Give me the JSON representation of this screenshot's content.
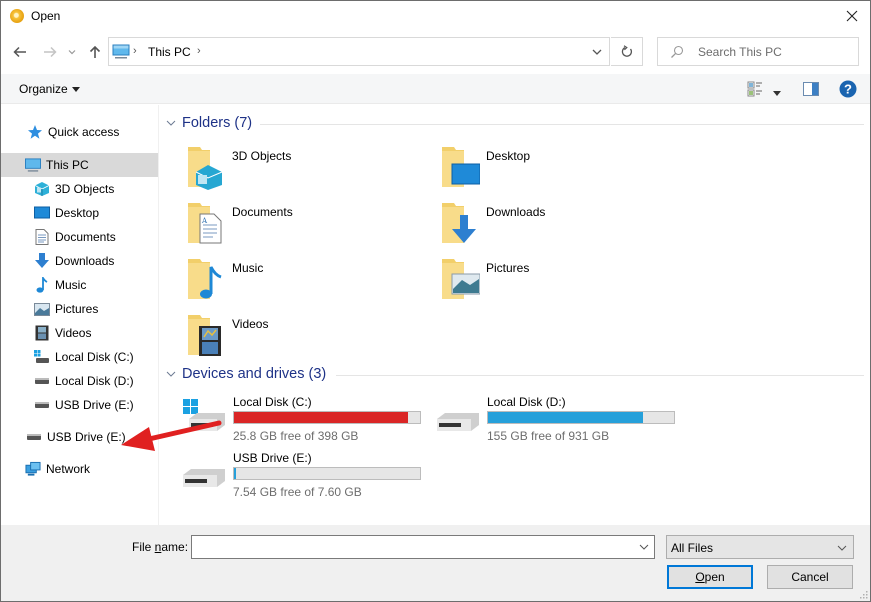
{
  "window": {
    "title": "Open",
    "app_icon": "chrome-canary-icon",
    "close_icon": "close-icon"
  },
  "nav": {
    "back_icon": "arrow-left-icon",
    "forward_icon": "arrow-right-icon",
    "recent_icon": "chevron-down-icon",
    "up_icon": "arrow-up-icon",
    "address": {
      "location_icon": "this-pc-icon",
      "path": [
        "This PC"
      ],
      "dropdown_icon": "chevron-down-icon"
    },
    "refresh_icon": "refresh-icon",
    "search": {
      "placeholder": "Search This PC",
      "value": "",
      "icon": "search-icon"
    }
  },
  "toolbar": {
    "organize_label": "Organize",
    "view_icon": "change-view-icon",
    "view_dropdown_icon": "caret-down-icon",
    "preview_pane_icon": "preview-pane-icon",
    "help_icon": "help-icon"
  },
  "sidebar": {
    "items": [
      {
        "label": "Quick access",
        "icon": "star-icon",
        "level": 0,
        "selected": false
      },
      {
        "label": "This PC",
        "icon": "this-pc-icon",
        "level": 0,
        "selected": true
      },
      {
        "label": "3D Objects",
        "icon": "cube-icon",
        "level": 1,
        "selected": false
      },
      {
        "label": "Desktop",
        "icon": "desktop-icon",
        "level": 1,
        "selected": false
      },
      {
        "label": "Documents",
        "icon": "document-icon",
        "level": 1,
        "selected": false
      },
      {
        "label": "Downloads",
        "icon": "download-icon",
        "level": 1,
        "selected": false
      },
      {
        "label": "Music",
        "icon": "music-note-icon",
        "level": 1,
        "selected": false
      },
      {
        "label": "Pictures",
        "icon": "picture-icon",
        "level": 1,
        "selected": false
      },
      {
        "label": "Videos",
        "icon": "film-icon",
        "level": 1,
        "selected": false
      },
      {
        "label": "Local Disk (C:)",
        "icon": "windows-drive-icon",
        "level": 1,
        "selected": false
      },
      {
        "label": "Local Disk (D:)",
        "icon": "drive-icon",
        "level": 1,
        "selected": false
      },
      {
        "label": "USB Drive (E:)",
        "icon": "drive-icon",
        "level": 1,
        "selected": false
      },
      {
        "label": "USB Drive (E:)",
        "icon": "drive-icon",
        "level": 0,
        "selected": false
      },
      {
        "label": "Network",
        "icon": "network-icon",
        "level": 0,
        "selected": false
      }
    ]
  },
  "content": {
    "folders_group": {
      "title": "Folders (7)",
      "items": [
        {
          "name": "3D Objects",
          "overlay": "cube-icon"
        },
        {
          "name": "Desktop",
          "overlay": "desktop-icon"
        },
        {
          "name": "Documents",
          "overlay": "document-icon"
        },
        {
          "name": "Downloads",
          "overlay": "download-icon"
        },
        {
          "name": "Music",
          "overlay": "music-note-icon"
        },
        {
          "name": "Pictures",
          "overlay": "picture-icon"
        },
        {
          "name": "Videos",
          "overlay": "film-icon"
        }
      ]
    },
    "drives_group": {
      "title": "Devices and drives (3)",
      "items": [
        {
          "name": "Local Disk (C:)",
          "free_text": "25.8 GB free of 398 GB",
          "used_fraction": 0.935,
          "bar_color": "#da2626",
          "icon": "windows-drive-icon"
        },
        {
          "name": "Local Disk (D:)",
          "free_text": "155 GB free of 931 GB",
          "used_fraction": 0.834,
          "bar_color": "#26a0da",
          "icon": "drive-icon"
        },
        {
          "name": "USB Drive (E:)",
          "free_text": "7.54 GB free of 7.60 GB",
          "used_fraction": 0.008,
          "bar_color": "#26a0da",
          "icon": "drive-icon"
        }
      ]
    }
  },
  "footer": {
    "file_name_label": "File name:",
    "file_name_value": "",
    "file_type_value": "All Files",
    "open_label": "Open",
    "cancel_label": "Cancel"
  },
  "annotation": {
    "arrow_color": "#e02020",
    "points_to": "USB Drive (E:)"
  }
}
